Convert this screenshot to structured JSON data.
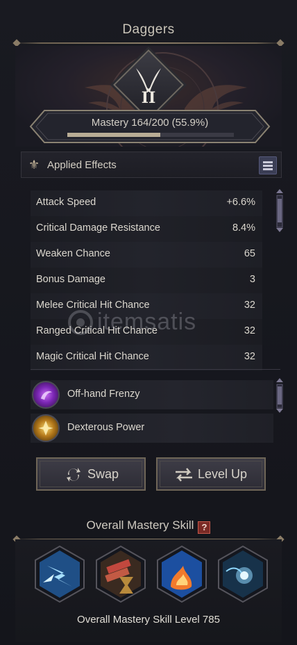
{
  "window": {
    "title": "Daggers"
  },
  "mastery": {
    "label": "Mastery 164/200 (55.9%)",
    "progress_fraction": 0.559,
    "rank_numeral": "II"
  },
  "applied_effects": {
    "header": "Applied Effects",
    "stats": [
      {
        "name": "Attack Speed",
        "value": "+6.6%"
      },
      {
        "name": "Critical Damage Resistance",
        "value": "8.4%"
      },
      {
        "name": "Weaken Chance",
        "value": "65"
      },
      {
        "name": "Bonus Damage",
        "value": "3"
      },
      {
        "name": "Melee Critical Hit Chance",
        "value": "32"
      },
      {
        "name": "Ranged Critical Hit Chance",
        "value": "32"
      },
      {
        "name": "Magic Critical Hit Chance",
        "value": "32"
      }
    ],
    "skills": [
      {
        "name": "Off-hand Frenzy",
        "icon": "purple-frenzy-icon"
      },
      {
        "name": "Dexterous Power",
        "icon": "gold-power-icon"
      }
    ]
  },
  "buttons": {
    "swap": "Swap",
    "level_up": "Level Up"
  },
  "overall": {
    "title": "Overall Mastery Skill",
    "help": "?",
    "level_label": "Overall Mastery Skill Level 785",
    "skill_icons": [
      "lightning-shatter-icon",
      "dynamite-hourglass-icon",
      "flame-burst-icon",
      "spirit-orb-icon"
    ]
  },
  "watermark": {
    "text": "itemsatis"
  },
  "colors": {
    "accent_gold": "#b9ad95",
    "panel": "#1e1f26",
    "help_red": "#7a2a25"
  }
}
